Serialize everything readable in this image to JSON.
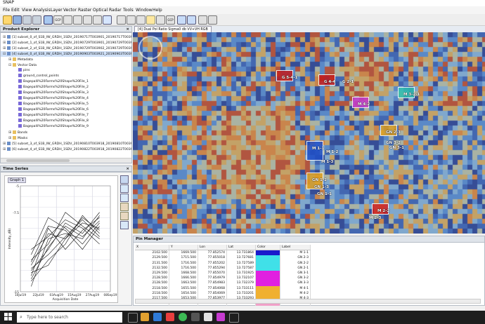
{
  "app_title": "SNAP",
  "menus": [
    "File",
    "Edit",
    "View",
    "Analysis",
    "Layer",
    "Vector",
    "Raster",
    "Optical",
    "Radar",
    "Tools",
    "Window",
    "Help"
  ],
  "toolbar_labels": {
    "gcp": "GCP",
    "gcp2": "GCP"
  },
  "explorer": {
    "title": "Product Explorer",
    "items": [
      {
        "label": "[1] subset_0_of_S1B_IW_GRDH_1SDV_20190717T003901_20190717T003926",
        "level": 0,
        "toggle": "+",
        "icon": "product"
      },
      {
        "label": "[2] subset_1_of_S1B_IW_GRDH_1SDV_20190729T003901_20190729T003926",
        "level": 0,
        "toggle": "+",
        "icon": "product"
      },
      {
        "label": "[3] subset_2_of_S1B_IW_GRDH_1SDV_20190729T003902_20190729T003926",
        "level": 0,
        "toggle": "+",
        "icon": "product"
      },
      {
        "label": "[4] subset_0_of_S1B_IW_GRDH_1SDV_20190903T003921_20190903T003946",
        "level": 0,
        "toggle": "-",
        "icon": "product"
      },
      {
        "label": "Metadata",
        "level": 1,
        "toggle": "+",
        "icon": "folder"
      },
      {
        "label": "Vector Data",
        "level": 1,
        "toggle": "-",
        "icon": "folder"
      },
      {
        "label": "pins",
        "level": 2,
        "toggle": "",
        "icon": "vector"
      },
      {
        "label": "ground_control_points",
        "level": 2,
        "toggle": "",
        "icon": "vector"
      },
      {
        "label": "Bagepalli%20Farms%20Shape%20File_1",
        "level": 2,
        "toggle": "",
        "icon": "vector"
      },
      {
        "label": "Bagepalli%20Farms%20Shape%20File_2",
        "level": 2,
        "toggle": "",
        "icon": "vector"
      },
      {
        "label": "Bagepalli%20Farms%20Shape%20File_3",
        "level": 2,
        "toggle": "",
        "icon": "vector"
      },
      {
        "label": "Bagepalli%20Farms%20Shape%20File_4",
        "level": 2,
        "toggle": "",
        "icon": "vector"
      },
      {
        "label": "Bagepalli%20Farms%20Shape%20File_5",
        "level": 2,
        "toggle": "",
        "icon": "vector"
      },
      {
        "label": "Bagepalli%20Farms%20Shape%20File_6",
        "level": 2,
        "toggle": "",
        "icon": "vector"
      },
      {
        "label": "Bagepalli%20Farms%20Shape%20File_7",
        "level": 2,
        "toggle": "",
        "icon": "vector"
      },
      {
        "label": "Bagepalli%20Farms%20Shape%20File_8",
        "level": 2,
        "toggle": "",
        "icon": "vector"
      },
      {
        "label": "Bagepalli%20Farms%20Shape%20File_9",
        "level": 2,
        "toggle": "",
        "icon": "vector"
      },
      {
        "label": "Bands",
        "level": 1,
        "toggle": "+",
        "icon": "folder"
      },
      {
        "label": "Masks",
        "level": 1,
        "toggle": "+",
        "icon": "folder"
      },
      {
        "label": "[5] subset_3_of_S1B_IW_GRDH_1SDV_20190810T003918_20190810T003943",
        "level": 0,
        "toggle": "+",
        "icon": "product"
      },
      {
        "label": "[6] subset_4_of_S1B_IW_GRDH_1SDV_20190822T003918_20190822T003943",
        "level": 0,
        "toggle": "+",
        "icon": "product"
      }
    ]
  },
  "timeseries": {
    "title": "Time Series",
    "tab": "Graph 1",
    "ylabel": "Intensity_dB)",
    "xlabel": "Acquisition Date",
    "yticks": [
      "-5",
      "-7.5",
      "-15"
    ],
    "xticks": [
      "10Jul19",
      "22Jul19",
      "03Aug19",
      "15Aug19",
      "27Aug19",
      "08Sep19"
    ]
  },
  "chart_data": {
    "type": "line",
    "xlabel": "Acquisition Date",
    "ylabel": "Intensity_dB)",
    "x": [
      "17Jul19",
      "29Jul19",
      "10Aug19",
      "22Aug19",
      "03Sep19"
    ],
    "ylim": [
      -15,
      -5
    ],
    "series": [
      {
        "values": [
          -12.5,
          -9.5,
          -10.0,
          -8.5,
          -9.0
        ]
      },
      {
        "values": [
          -13.0,
          -11.0,
          -8.5,
          -9.5,
          -7.5
        ]
      },
      {
        "values": [
          -11.5,
          -8.0,
          -9.0,
          -10.5,
          -8.5
        ]
      },
      {
        "values": [
          -14.0,
          -12.0,
          -10.5,
          -7.8,
          -9.5
        ]
      },
      {
        "values": [
          -12.0,
          -10.5,
          -7.5,
          -8.8,
          -10.0
        ]
      },
      {
        "values": [
          -13.5,
          -9.0,
          -11.0,
          -9.2,
          -8.0
        ]
      },
      {
        "values": [
          -12.8,
          -11.5,
          -9.8,
          -8.2,
          -9.8
        ]
      },
      {
        "values": [
          -14.5,
          -10.0,
          -9.5,
          -10.0,
          -7.8
        ]
      },
      {
        "values": [
          -11.0,
          -9.8,
          -8.2,
          -9.0,
          -10.5
        ]
      },
      {
        "values": [
          -13.2,
          -12.5,
          -10.0,
          -8.0,
          -9.2
        ]
      },
      {
        "values": [
          -12.2,
          -8.8,
          -9.2,
          -11.0,
          -8.8
        ]
      },
      {
        "values": [
          -13.8,
          -10.8,
          -8.8,
          -9.8,
          -8.3
        ]
      }
    ]
  },
  "imageview": {
    "tab_label": "[4] Dual Pol Ratio Sigma0 db VV+VH RGB",
    "pins": [
      {
        "label": "G 5-4-1",
        "color": "#c21a1a"
      },
      {
        "label": "G 4-4",
        "color": "#c21a1a"
      },
      {
        "label": "G 2-1",
        "color": "#c21a1a"
      },
      {
        "label": "M 4-2",
        "color": "#c23ad0"
      },
      {
        "label": "M 3-2-1",
        "color": "#2fbfb0"
      },
      {
        "label": "GN 2-3",
        "color": "#e0a020"
      },
      {
        "label": "GN 3-2",
        "color": "#e0a020"
      },
      {
        "label": "GN 3-1",
        "color": "#e0a020"
      },
      {
        "label": "M 1-1",
        "color": "#2050c8"
      },
      {
        "label": "M 1-2",
        "color": "#2050c8"
      },
      {
        "label": "M 1-3",
        "color": "#2050c8"
      },
      {
        "label": "GN 1-2",
        "color": "#e0a020"
      },
      {
        "label": "GN 1-3",
        "color": "#e0a020"
      },
      {
        "label": "GN 1-1",
        "color": "#e0a020"
      },
      {
        "label": "M 2-2",
        "color": "#d02020"
      },
      {
        "label": "M 2-3",
        "color": "#d02020"
      }
    ]
  },
  "pin_manager": {
    "title": "Pin Manager",
    "columns": [
      "X",
      "Y",
      "Lon",
      "Lat",
      "Color",
      "Label"
    ],
    "rows": [
      {
        "x": "2102.500",
        "y": "1669.500",
        "lon": "77.852574",
        "lat": "13.731864",
        "color": "#1a1acc",
        "label": "M 1-1"
      },
      {
        "x": "2129.500",
        "y": "1715.500",
        "lon": "77.855018",
        "lat": "13.727681",
        "color": "#40e0e8",
        "label": "GN 2-3"
      },
      {
        "x": "2131.500",
        "y": "1716.500",
        "lon": "77.855202",
        "lat": "13.727589",
        "color": "#40e0e8",
        "label": "GN 2-2"
      },
      {
        "x": "2132.500",
        "y": "1716.500",
        "lon": "77.855294",
        "lat": "13.727587",
        "color": "#40e0e8",
        "label": "GN 2-1"
      },
      {
        "x": "2129.500",
        "y": "1668.500",
        "lon": "77.855070",
        "lat": "13.731925",
        "color": "#e020e0",
        "label": "GN 3-1"
      },
      {
        "x": "2128.500",
        "y": "1666.500",
        "lon": "77.854979",
        "lat": "13.732107",
        "color": "#e020e0",
        "label": "GN 3-2"
      },
      {
        "x": "2128.500",
        "y": "1663.500",
        "lon": "77.854983",
        "lat": "13.732379",
        "color": "#e020e0",
        "label": "GN 3-3"
      },
      {
        "x": "2118.500",
        "y": "1655.500",
        "lon": "77.854068",
        "lat": "13.733111",
        "color": "#f0b030",
        "label": "M 4-1"
      },
      {
        "x": "2118.500",
        "y": "1654.500",
        "lon": "77.854069",
        "lat": "13.733201",
        "color": "#f0b030",
        "label": "M 4-2"
      },
      {
        "x": "2117.500",
        "y": "1653.500",
        "lon": "77.853977",
        "lat": "13.733293",
        "color": "#f0b030",
        "label": "M 4-3"
      },
      {
        "x": "2136.500",
        "y": "1651.500",
        "lon": "77.855735",
        "lat": "13.733453",
        "color": "#f0a0c8",
        "label": "M 3-1"
      }
    ]
  },
  "taskbar": {
    "search_placeholder": "Type here to search"
  }
}
